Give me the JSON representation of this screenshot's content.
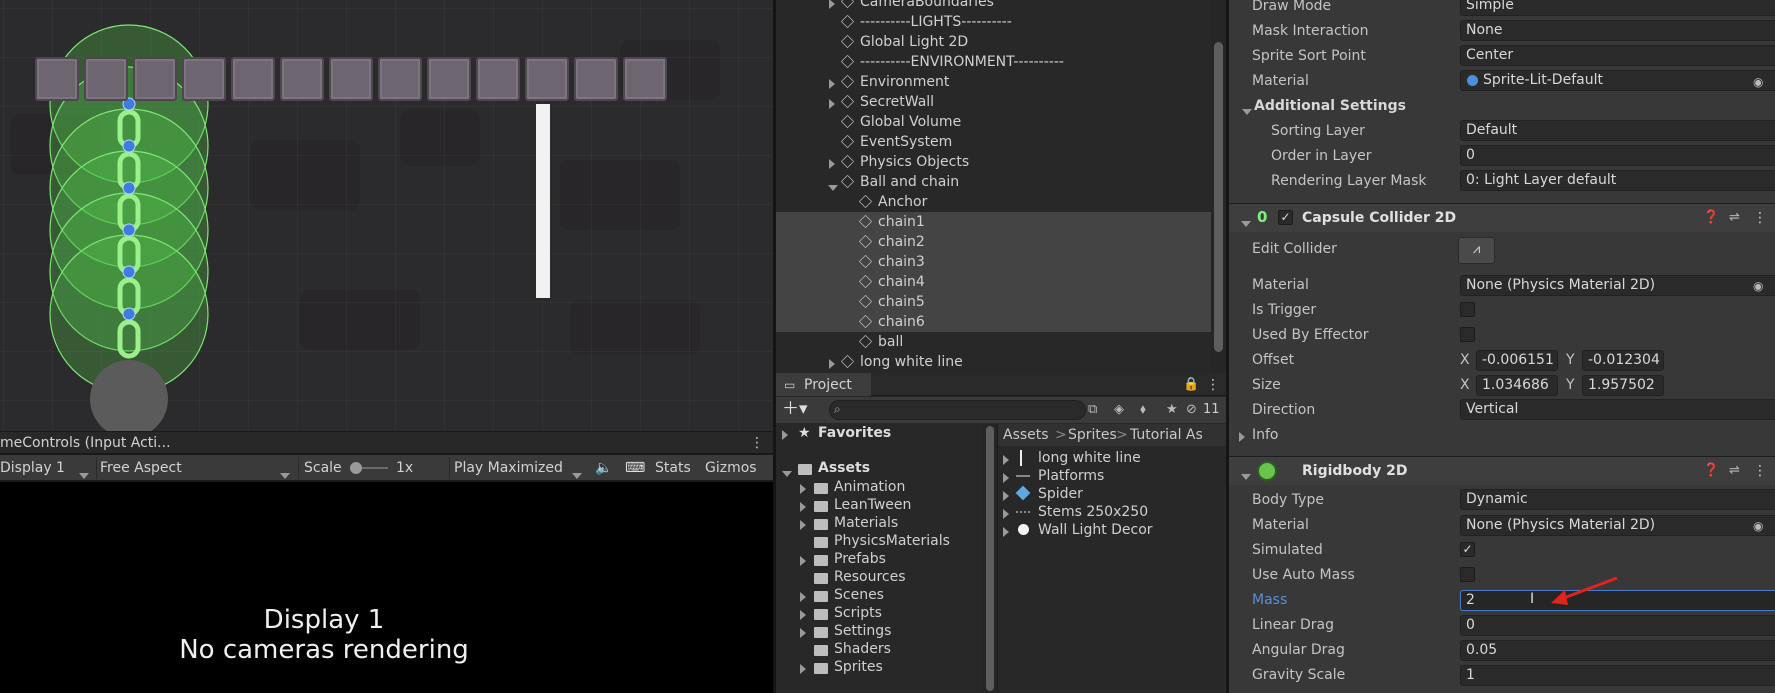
{
  "scene": {
    "game_view_tab": "meControls (Input Acti...",
    "display_dropdown": "Display 1",
    "aspect_dropdown": "Free Aspect",
    "scale_label": "Scale",
    "scale_value": "1x",
    "play_mode_dropdown": "Play Maximized",
    "stats_button": "Stats",
    "gizmos_button": "Gizmos",
    "no_camera_line1": "Display 1",
    "no_camera_line2": "No cameras rendering"
  },
  "hierarchy": {
    "items": [
      {
        "label": "CameraBoundaries",
        "arrow": true,
        "indent": 0
      },
      {
        "label": "----------LIGHTS----------",
        "arrow": false,
        "indent": 0
      },
      {
        "label": "Global Light 2D",
        "arrow": false,
        "indent": 0
      },
      {
        "label": "----------ENVIRONMENT----------",
        "arrow": false,
        "indent": 0
      },
      {
        "label": "Environment",
        "arrow": true,
        "indent": 0
      },
      {
        "label": "SecretWall",
        "arrow": true,
        "indent": 0
      },
      {
        "label": "Global Volume",
        "arrow": false,
        "indent": 0
      },
      {
        "label": "EventSystem",
        "arrow": false,
        "indent": 0
      },
      {
        "label": "Physics Objects",
        "arrow": true,
        "indent": 0
      },
      {
        "label": "Ball and chain",
        "arrow": "down",
        "indent": 0
      },
      {
        "label": "Anchor",
        "arrow": false,
        "indent": 1
      },
      {
        "label": "chain1",
        "arrow": false,
        "indent": 1,
        "selected": true
      },
      {
        "label": "chain2",
        "arrow": false,
        "indent": 1,
        "selected": true
      },
      {
        "label": "chain3",
        "arrow": false,
        "indent": 1,
        "selected": true
      },
      {
        "label": "chain4",
        "arrow": false,
        "indent": 1,
        "selected": true
      },
      {
        "label": "chain5",
        "arrow": false,
        "indent": 1,
        "selected": true
      },
      {
        "label": "chain6",
        "arrow": false,
        "indent": 1,
        "selected": true
      },
      {
        "label": "ball",
        "arrow": false,
        "indent": 1
      },
      {
        "label": "long white line",
        "arrow": true,
        "indent": 0
      }
    ]
  },
  "project": {
    "tab": "Project",
    "hidden_count": "11",
    "favorites": "Favorites",
    "assets": "Assets",
    "folders": [
      "Animation",
      "LeanTween",
      "Materials",
      "PhysicsMaterials",
      "Prefabs",
      "Resources",
      "Scenes",
      "Scripts",
      "Settings",
      "Shaders",
      "Sprites"
    ],
    "folder_arrows": [
      true,
      true,
      true,
      false,
      true,
      false,
      true,
      true,
      true,
      false,
      true
    ],
    "breadcrumb": [
      "Assets",
      "Sprites",
      "Tutorial As"
    ],
    "files": [
      "long white line",
      "Platforms",
      "Spider",
      "Stems 250x250",
      "Wall Light Decor"
    ]
  },
  "inspector": {
    "draw_mode_label": "Draw Mode",
    "draw_mode": "Simple",
    "mask_label": "Mask Interaction",
    "mask": "None",
    "sort_point_label": "Sprite Sort Point",
    "sort_point": "Center",
    "material_label": "Material",
    "material": "Sprite-Lit-Default",
    "additional_settings": "Additional Settings",
    "sorting_layer_label": "Sorting Layer",
    "sorting_layer": "Default",
    "order_label": "Order in Layer",
    "order": "0",
    "rendering_mask_label": "Rendering Layer Mask",
    "rendering_mask": "0: Light Layer default",
    "capsule_title": "Capsule Collider 2D",
    "edit_collider_label": "Edit Collider",
    "cc_material_label": "Material",
    "cc_material": "None (Physics Material 2D)",
    "is_trigger_label": "Is Trigger",
    "used_by_effector_label": "Used By Effector",
    "offset_label": "Offset",
    "offset_x": "-0.006151",
    "offset_y": "-0.012304",
    "size_label": "Size",
    "size_x": "1.034686",
    "size_y": "1.957502",
    "direction_label": "Direction",
    "direction": "Vertical",
    "info_label": "Info",
    "x": "X",
    "y": "Y",
    "rb_title": "Rigidbody 2D",
    "body_type_label": "Body Type",
    "body_type": "Dynamic",
    "rb_material_label": "Material",
    "rb_material": "None (Physics Material 2D)",
    "simulated_label": "Simulated",
    "auto_mass_label": "Use Auto Mass",
    "mass_label": "Mass",
    "mass": "2",
    "linear_drag_label": "Linear Drag",
    "linear_drag": "0",
    "angular_drag_label": "Angular Drag",
    "angular_drag": "0.05",
    "gravity_label": "Gravity Scale",
    "gravity": "1"
  },
  "colors": {
    "accent_blue": "#5a8fd6",
    "annotation_red": "#e0231c",
    "selection": "#4a4a4a",
    "collider_green": "#5fd85a"
  }
}
